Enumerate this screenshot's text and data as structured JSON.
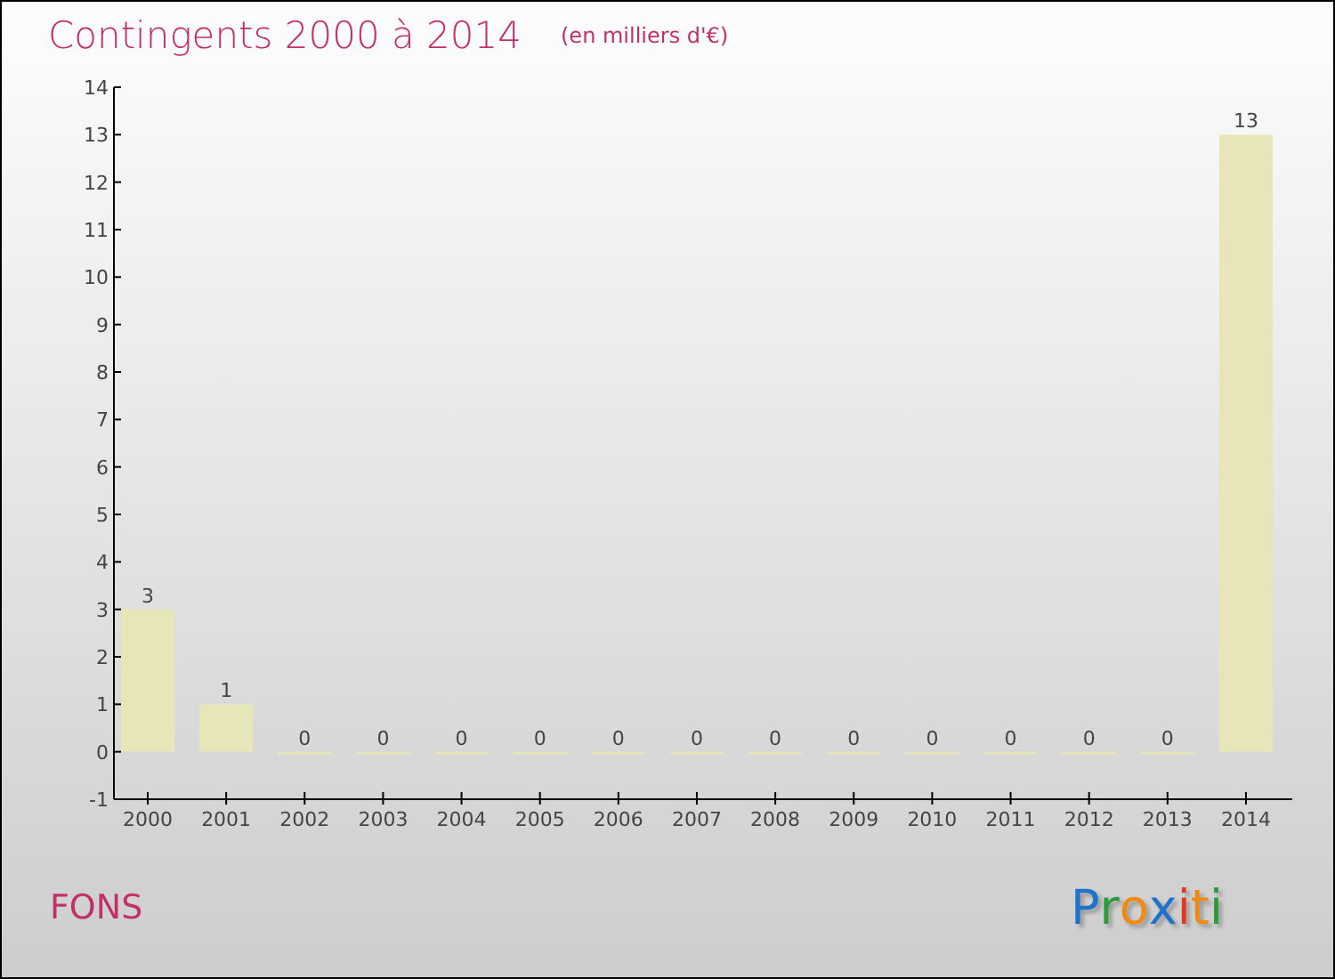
{
  "title": "Contingents 2000 à 2014",
  "subtitle": "(en milliers d'€)",
  "chart_data": {
    "type": "bar",
    "categories": [
      "2000",
      "2001",
      "2002",
      "2003",
      "2004",
      "2005",
      "2006",
      "2007",
      "2008",
      "2009",
      "2010",
      "2011",
      "2012",
      "2013",
      "2014"
    ],
    "series": [
      {
        "color": "#e6e6b8",
        "values": [
          3,
          1,
          0,
          0,
          0,
          0,
          0,
          0,
          0,
          0,
          0,
          0,
          0,
          0,
          13
        ]
      }
    ],
    "ylim": [
      -1,
      14
    ],
    "yticks": [
      -1,
      0,
      1,
      2,
      3,
      4,
      5,
      6,
      7,
      8,
      9,
      10,
      11,
      12,
      13,
      14
    ],
    "data_labels": true
  },
  "place": "FONS",
  "logo": [
    {
      "text": "P",
      "color": "#1f73c8"
    },
    {
      "text": "r",
      "color": "#2e9b3a"
    },
    {
      "text": "o",
      "color": "#f08a10"
    },
    {
      "text": "x",
      "color": "#1f73c8"
    },
    {
      "text": "i",
      "color": "#e23a1c"
    },
    {
      "text": "t",
      "color": "#f08a10"
    },
    {
      "text": "i",
      "color": "#2e9b3a"
    }
  ]
}
